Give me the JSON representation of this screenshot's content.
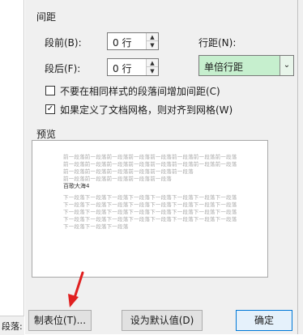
{
  "left_status": "段落: 调",
  "section_spacing": "间距",
  "before_label": "段前(B):",
  "before_value": "0 行",
  "after_label": "段后(F):",
  "after_value": "0 行",
  "line_spacing_label": "行距(N):",
  "line_spacing_value": "单倍行距",
  "chk_no_space_label": "不要在相同样式的段落间增加间距(C)",
  "chk_snap_grid_label": "如果定义了文档网格，则对齐到网格(W)",
  "preview_label": "预览",
  "preview_before_text": [
    "前一段落前一段落前一段落前一段落前一段落前一段落前一段落前一段落",
    "前一段落前一段落前一段落前一段落前一段落前一段落前一段落前一段落",
    "前一段落前一段落前一段落前一段落前一段落前一段落",
    "前一段落前一段落前一段落前一段落前一段落"
  ],
  "preview_sample_text": "百歌大海4",
  "preview_after_text": [
    "下一段落下一段落下一段落下一段落下一段落下一段落下一段落下一段落",
    "下一段落下一段落下一段落下一段落下一段落下一段落下一段落下一段落",
    "下一段落下一段落下一段落下一段落下一段落下一段落下一段落下一段落",
    "下一段落下一段落下一段落下一段落下一段落下一段落下一段落下一段落",
    "下一段落下一段落下一段落"
  ],
  "buttons": {
    "tabs": "制表位(T)...",
    "set_default": "设为默认值(D)",
    "ok": "确定"
  },
  "colors": {
    "dialog_bg": "#f0f0f0",
    "combo_bg": "#c6efce",
    "annotation_arrow": "#e02020"
  }
}
